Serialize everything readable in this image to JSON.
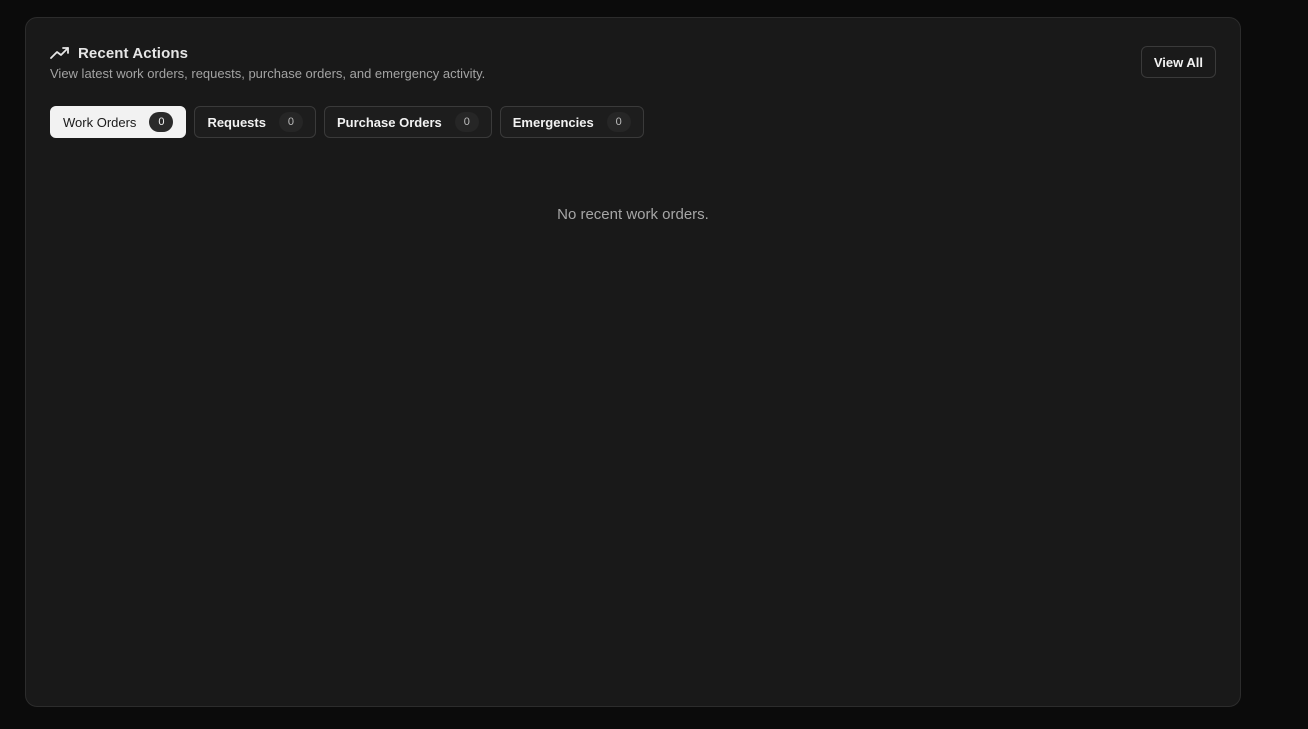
{
  "card": {
    "title": "Recent Actions",
    "title_icon": "trending-up-icon",
    "subtitle": "View latest work orders, requests, purchase orders, and emergency activity.",
    "view_all_label": "View All"
  },
  "tabs": [
    {
      "label": "Work Orders",
      "count": "0",
      "active": true
    },
    {
      "label": "Requests",
      "count": "0",
      "active": false
    },
    {
      "label": "Purchase Orders",
      "count": "0",
      "active": false
    },
    {
      "label": "Emergencies",
      "count": "0",
      "active": false
    }
  ],
  "empty_state": {
    "message": "No recent work orders."
  },
  "colors": {
    "page_bg": "#0b0b0b",
    "card_bg": "#191919",
    "active_tab_bg": "#f2f2f2"
  }
}
